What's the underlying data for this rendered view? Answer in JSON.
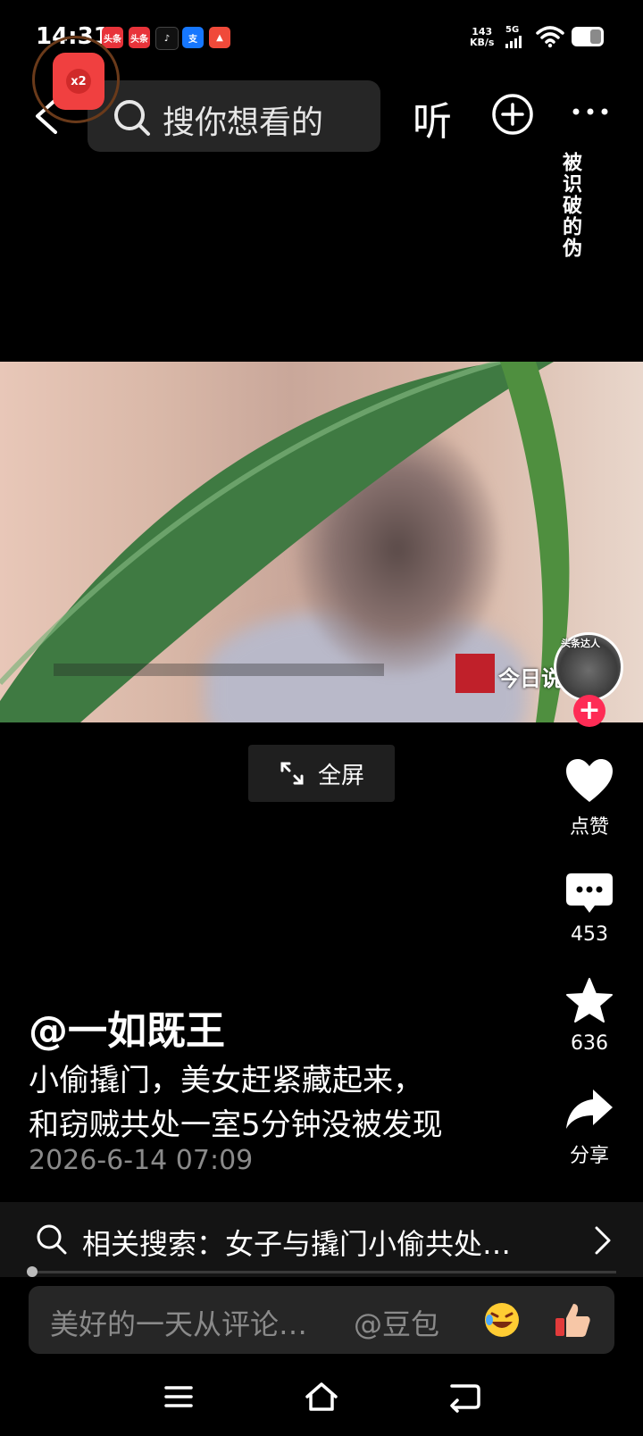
{
  "status_bar": {
    "time": "14:31",
    "app_icons": [
      "头条",
      "头条",
      "♪",
      "支",
      "▲"
    ],
    "net_speed_value": "143",
    "net_speed_unit": "KB/s",
    "network": "5G"
  },
  "reward": {
    "badge": "x2"
  },
  "top_nav": {
    "search_placeholder": "搜你想看的",
    "listen_label": "听"
  },
  "video": {
    "overlay_text": "被识破的伪",
    "channel_label": "今日说",
    "avatar_badge_text": "头条达人"
  },
  "fullscreen": {
    "label": "全屏"
  },
  "actions": {
    "like_label": "点赞",
    "comment_count": "453",
    "favorite_count": "636",
    "share_label": "分享"
  },
  "post": {
    "author": "@一如既王",
    "caption_line1": "小偷撬门，美女赶紧藏起来，",
    "caption_line2": "和窃贼共处一室5分钟没被发现",
    "time": "2026-6-14 07:09"
  },
  "related_search": {
    "text": "相关搜索：女子与撬门小偷共处…"
  },
  "comment_bar": {
    "placeholder": "美好的一天从评论…",
    "mention": "@豆包"
  },
  "colors": {
    "accent": "#fe2c55",
    "background": "#000000"
  }
}
